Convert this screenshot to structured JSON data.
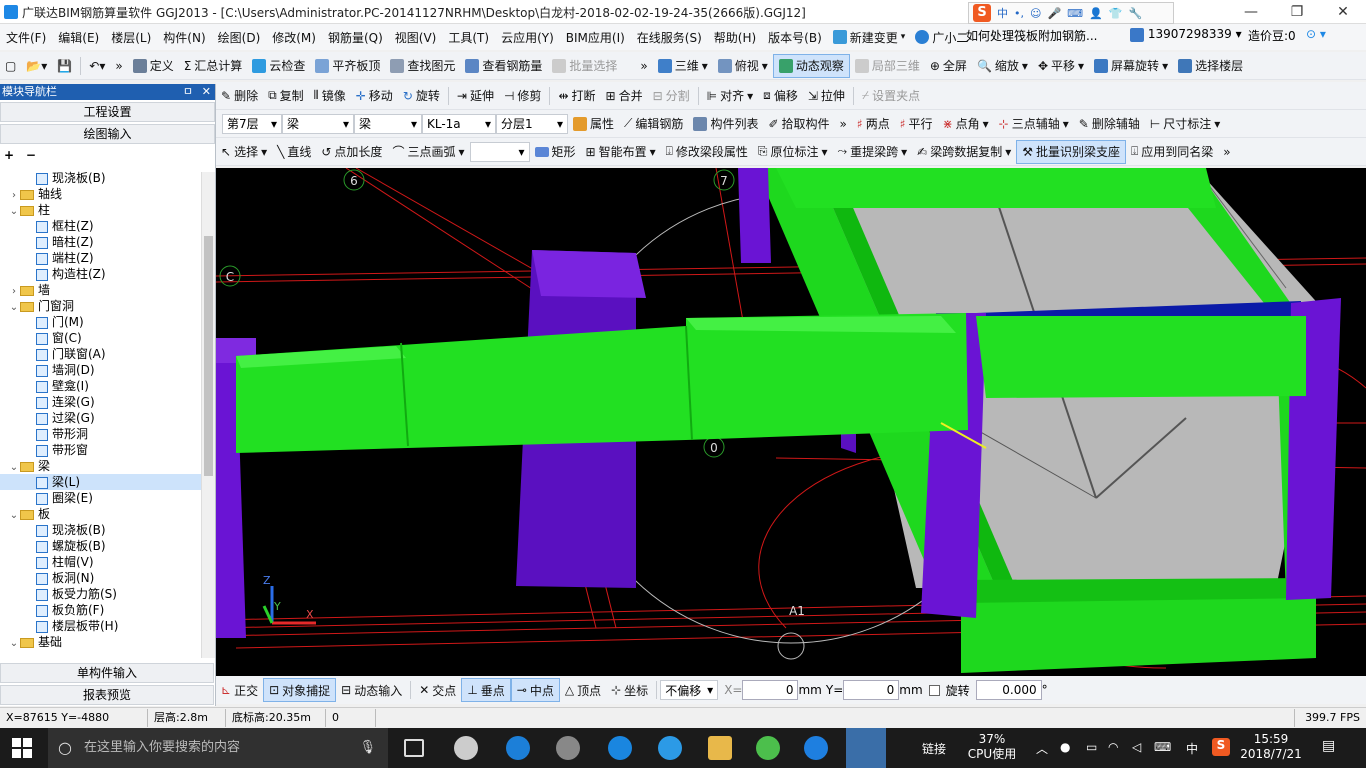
{
  "window": {
    "title": "广联达BIM钢筋算量软件 GGJ2013 - [C:\\Users\\Administrator.PC-20141127NRHM\\Desktop\\白龙村-2018-02-02-19-24-35(2666版).GGJ12]",
    "ime_label": "中",
    "min": "—",
    "max": "❐",
    "close": "✕"
  },
  "menu": {
    "items": [
      "文件(F)",
      "编辑(E)",
      "楼层(L)",
      "构件(N)",
      "绘图(D)",
      "修改(M)",
      "钢筋量(Q)",
      "视图(V)",
      "工具(T)",
      "云应用(Y)",
      "BIM应用(I)",
      "在线服务(S)",
      "帮助(H)",
      "版本号(B)"
    ],
    "new_change": "新建变更",
    "guangxiaoer": "广小二",
    "question": "如何处理筏板附加钢筋...",
    "phone": "13907298339",
    "beans": "造价豆:0"
  },
  "toolbar1": {
    "define": "定义",
    "sum": "汇总计算",
    "cloud_check": "云检查",
    "flat_top": "平齐板顶",
    "find": "查找图元",
    "view_rebar": "查看钢筋量",
    "batch_select": "批量选择",
    "view3d": "三维",
    "top_view": "俯视",
    "dynamic_view": "动态观察",
    "local3d": "局部三维",
    "fullscreen": "全屏",
    "zoom": "缩放",
    "pan": "平移",
    "rotate": "屏幕旋转",
    "select_floor": "选择楼层"
  },
  "toolbar2": {
    "delete": "删除",
    "copy": "复制",
    "mirror": "镜像",
    "move": "移动",
    "rotate": "旋转",
    "extend": "延伸",
    "trim": "修剪",
    "break": "打断",
    "merge": "合并",
    "split": "分割",
    "align": "对齐",
    "offset": "偏移",
    "stretch": "拉伸",
    "set_point": "设置夹点"
  },
  "toolbar3": {
    "floor": "第7层",
    "type1": "梁",
    "type2": "梁",
    "component": "KL-1a",
    "layer": "分层1",
    "property": "属性",
    "edit_rebar": "编辑钢筋",
    "component_list": "构件列表",
    "pick": "拾取构件",
    "two_points": "两点",
    "parallel": "平行",
    "point_angle": "点角",
    "three_point_aux": "三点辅轴",
    "delete_aux": "删除辅轴",
    "dimension": "尺寸标注"
  },
  "toolbar4": {
    "select": "选择",
    "line": "直线",
    "point_length": "点加长度",
    "three_point_arc": "三点画弧",
    "rect": "矩形",
    "smart_layout": "智能布置",
    "modify_span": "修改梁段属性",
    "orig_label": "原位标注",
    "re_extract": "重提梁跨",
    "span_copy": "梁跨数据复制",
    "batch_identify": "批量识别梁支座",
    "apply_same": "应用到同名梁"
  },
  "sidebar": {
    "title": "模块导航栏",
    "pin": "ㅁ",
    "close": "✕",
    "project_settings": "工程设置",
    "drawing_input": "绘图输入",
    "single_input": "单构件输入",
    "report_preview": "报表预览",
    "tree": [
      {
        "level": 2,
        "type": "leaf",
        "text": "现浇板(B)"
      },
      {
        "level": 1,
        "type": "folder",
        "ex": "›",
        "text": "轴线"
      },
      {
        "level": 1,
        "type": "folder",
        "ex": "⌄",
        "text": "柱"
      },
      {
        "level": 2,
        "type": "leaf",
        "text": "框柱(Z)"
      },
      {
        "level": 2,
        "type": "leaf",
        "text": "暗柱(Z)"
      },
      {
        "level": 2,
        "type": "leaf",
        "text": "端柱(Z)"
      },
      {
        "level": 2,
        "type": "leaf",
        "text": "构造柱(Z)"
      },
      {
        "level": 1,
        "type": "folder",
        "ex": "›",
        "text": "墙"
      },
      {
        "level": 1,
        "type": "folder",
        "ex": "⌄",
        "text": "门窗洞"
      },
      {
        "level": 2,
        "type": "leaf",
        "text": "门(M)"
      },
      {
        "level": 2,
        "type": "leaf",
        "text": "窗(C)"
      },
      {
        "level": 2,
        "type": "leaf",
        "text": "门联窗(A)"
      },
      {
        "level": 2,
        "type": "leaf",
        "text": "墙洞(D)"
      },
      {
        "level": 2,
        "type": "leaf",
        "text": "壁龛(I)"
      },
      {
        "level": 2,
        "type": "leaf",
        "text": "连梁(G)"
      },
      {
        "level": 2,
        "type": "leaf",
        "text": "过梁(G)"
      },
      {
        "level": 2,
        "type": "leaf",
        "text": "带形洞"
      },
      {
        "level": 2,
        "type": "leaf",
        "text": "带形窗"
      },
      {
        "level": 1,
        "type": "folder",
        "ex": "⌄",
        "text": "梁"
      },
      {
        "level": 2,
        "type": "leaf",
        "text": "梁(L)",
        "selected": true
      },
      {
        "level": 2,
        "type": "leaf",
        "text": "圈梁(E)"
      },
      {
        "level": 1,
        "type": "folder",
        "ex": "⌄",
        "text": "板"
      },
      {
        "level": 2,
        "type": "leaf",
        "text": "现浇板(B)"
      },
      {
        "level": 2,
        "type": "leaf",
        "text": "螺旋板(B)"
      },
      {
        "level": 2,
        "type": "leaf",
        "text": "柱帽(V)"
      },
      {
        "level": 2,
        "type": "leaf",
        "text": "板洞(N)"
      },
      {
        "level": 2,
        "type": "leaf",
        "text": "板受力筋(S)"
      },
      {
        "level": 2,
        "type": "leaf",
        "text": "板负筋(F)"
      },
      {
        "level": 2,
        "type": "leaf",
        "text": "楼层板带(H)"
      },
      {
        "level": 1,
        "type": "folder",
        "ex": "⌄",
        "text": "基础"
      }
    ]
  },
  "canvas": {
    "axis_labels": [
      "6",
      "7",
      "C",
      "0",
      "A1"
    ],
    "axes": [
      "Z",
      "Y",
      "X"
    ]
  },
  "bottom": {
    "ortho": "正交",
    "snap": "对象捕捉",
    "dynamic_input": "动态输入",
    "intersection": "交点",
    "perp": "垂点",
    "mid": "中点",
    "vertex": "顶点",
    "coord": "坐标",
    "no_offset": "不偏移",
    "x_label": "X=",
    "x_value": "0",
    "mm1": "mm",
    "y_label": "Y=",
    "y_value": "0",
    "mm2": "mm",
    "rotate": "旋转",
    "rotate_value": "0.000",
    "deg": "°"
  },
  "status": {
    "coords": "X=87615 Y=-4880",
    "floor_height": "层高:2.8m",
    "base_height": "底标高:20.35m",
    "count": "0",
    "fps": "399.7 FPS"
  },
  "taskbar": {
    "search": "在这里输入你要搜索的内容",
    "link": "链接",
    "cpu_pct": "37%",
    "cpu_label": "CPU使用",
    "lang": "中",
    "time": "15:59",
    "date": "2018/7/21"
  },
  "colors": {
    "beam_green": "#22ee22",
    "column_purple": "#6a14d4",
    "slab_gray": "#b8b8b8",
    "title_blue": "#1f5fb0"
  }
}
